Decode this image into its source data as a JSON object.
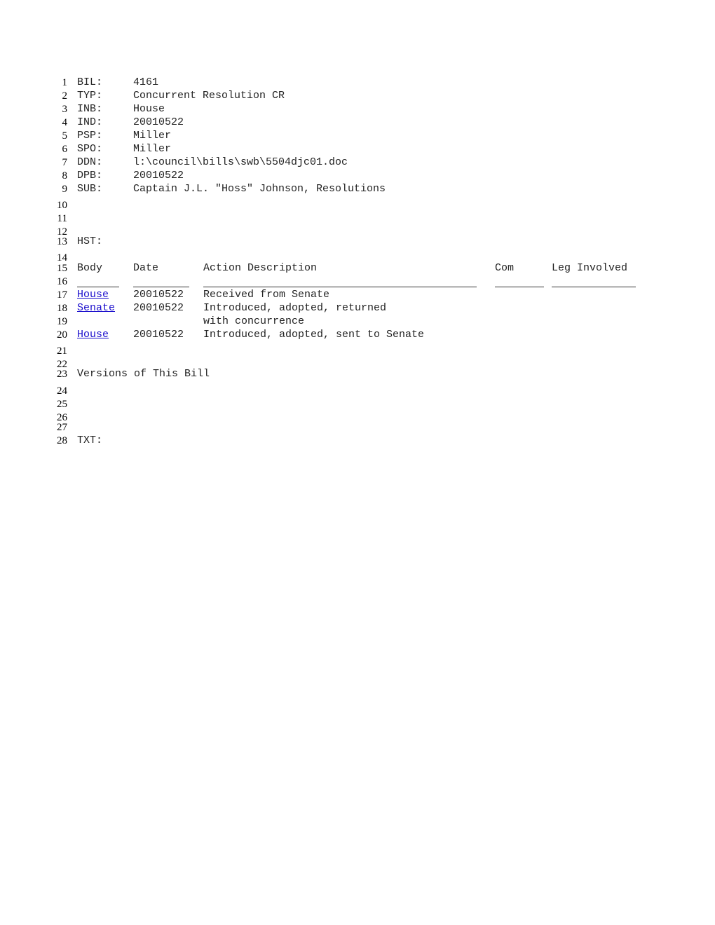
{
  "fields": [
    {
      "label": "BIL:",
      "value": "4161"
    },
    {
      "label": "TYP:",
      "value": "Concurrent Resolution CR"
    },
    {
      "label": "INB:",
      "value": "House"
    },
    {
      "label": "IND:",
      "value": "20010522"
    },
    {
      "label": "PSP:",
      "value": "Miller"
    },
    {
      "label": "SPO:",
      "value": "Miller"
    },
    {
      "label": "DDN:",
      "value": "l:\\council\\bills\\swb\\5504djc01.doc"
    },
    {
      "label": "DPB:",
      "value": "20010522"
    },
    {
      "label": "SUB:",
      "value": "Captain J.L. \"Hoss\" Johnson, Resolutions"
    }
  ],
  "history_label": "HST:",
  "history_headers": {
    "body": "Body",
    "date": "Date",
    "action": "Action Description",
    "com": "Com",
    "leg": "Leg Involved"
  },
  "history_rows": [
    {
      "body": "House",
      "date": "20010522",
      "action": "Received from Senate"
    },
    {
      "body": "Senate",
      "date": "20010522",
      "action": "Introduced, adopted, returned",
      "action_cont": "with concurrence"
    },
    {
      "body": "House",
      "date": "20010522",
      "action": "Introduced, adopted, sent to Senate"
    }
  ],
  "versions_label": "Versions of This Bill",
  "text_label": "TXT:",
  "line_numbers": [
    "1",
    "2",
    "3",
    "4",
    "5",
    "6",
    "7",
    "8",
    "9",
    "10",
    "11",
    "12",
    "13",
    "14",
    "15",
    "16",
    "17",
    "18",
    "19",
    "20",
    "21",
    "22",
    "23",
    "24",
    "25",
    "26",
    "27",
    "28"
  ]
}
